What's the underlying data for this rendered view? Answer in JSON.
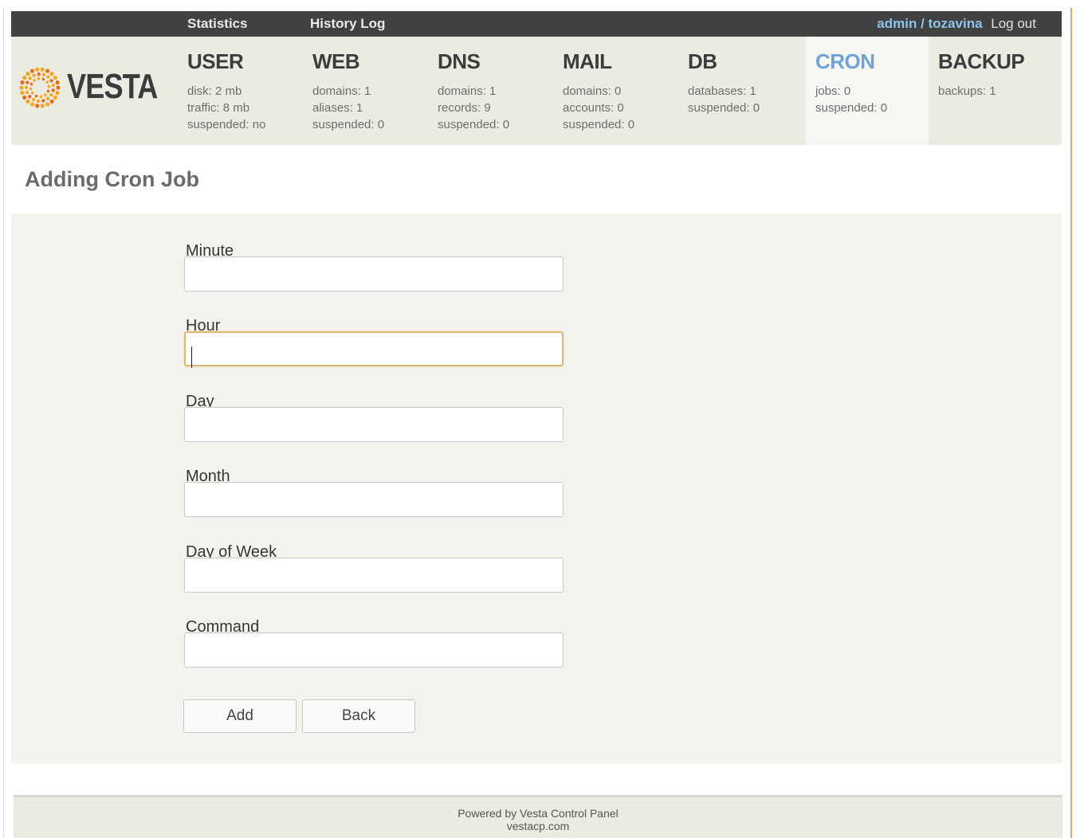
{
  "topbar": {
    "statistics": "Statistics",
    "history_log": "History Log",
    "user": "admin / tozavina",
    "logout": "Log out"
  },
  "logo": {
    "text": "VESTA",
    "icon": "vesta-sun-logo-icon",
    "colors": [
      "#f5a623",
      "#e46c21"
    ]
  },
  "nav": {
    "user": {
      "title": "USER",
      "stats": [
        "disk: 2 mb",
        "traffic: 8 mb",
        "suspended: no"
      ]
    },
    "web": {
      "title": "WEB",
      "stats": [
        "domains: 1",
        "aliases: 1",
        "suspended: 0"
      ]
    },
    "dns": {
      "title": "DNS",
      "stats": [
        "domains: 1",
        "records: 9",
        "suspended: 0"
      ]
    },
    "mail": {
      "title": "MAIL",
      "stats": [
        "domains: 0",
        "accounts: 0",
        "suspended: 0"
      ]
    },
    "db": {
      "title": "DB",
      "stats": [
        "databases: 1",
        "suspended: 0"
      ]
    },
    "cron": {
      "title": "CRON",
      "stats": [
        "jobs: 0",
        "suspended: 0"
      ],
      "active": true
    },
    "backup": {
      "title": "BACKUP",
      "stats": [
        "backups: 1"
      ]
    }
  },
  "page_title": "Adding Cron Job",
  "form": {
    "minute": {
      "label": "Minute",
      "value": ""
    },
    "hour": {
      "label": "Hour",
      "value": "",
      "focused": true
    },
    "day": {
      "label": "Day",
      "value": ""
    },
    "month": {
      "label": "Month",
      "value": ""
    },
    "dow": {
      "label": "Day of Week",
      "value": ""
    },
    "command": {
      "label": "Command",
      "value": ""
    },
    "add_label": "Add",
    "back_label": "Back"
  },
  "footer": {
    "line1": "Powered by Vesta Control Panel",
    "line2": "vestacp.com"
  },
  "colors": {
    "accent": "#6fa2d6",
    "topbar": "#414141",
    "panel": "#ebebe1",
    "focus": "#e0b673"
  }
}
